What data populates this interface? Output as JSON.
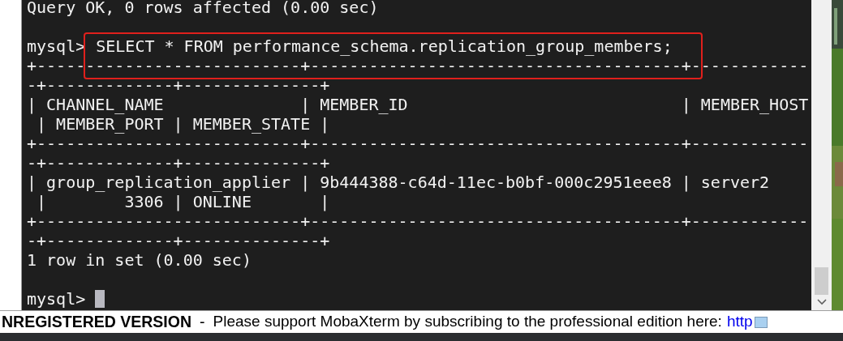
{
  "terminal": {
    "lines": [
      {
        "kind": "output",
        "text": "Query OK, 0 rows affected (0.00 sec)"
      },
      {
        "kind": "blank"
      },
      {
        "kind": "prompt",
        "prompt": "mysql>",
        "command": "SELECT * FROM performance_schema.replication_group_members;",
        "highlighted": true
      },
      {
        "kind": "output",
        "text": "+---------------------------+--------------------------------------+------------"
      },
      {
        "kind": "output",
        "text": "-+-------------+--------------+"
      },
      {
        "kind": "output",
        "text": "| CHANNEL_NAME              | MEMBER_ID                            | MEMBER_HOST"
      },
      {
        "kind": "output",
        "text": " | MEMBER_PORT | MEMBER_STATE |"
      },
      {
        "kind": "output",
        "text": "+---------------------------+--------------------------------------+------------"
      },
      {
        "kind": "output",
        "text": "-+-------------+--------------+"
      },
      {
        "kind": "output",
        "text": "| group_replication_applier | 9b444388-c64d-11ec-b0bf-000c2951eee8 | server2"
      },
      {
        "kind": "output",
        "text": " |        3306 | ONLINE       |"
      },
      {
        "kind": "output",
        "text": "+---------------------------+--------------------------------------+------------"
      },
      {
        "kind": "output",
        "text": "-+-------------+--------------+"
      },
      {
        "kind": "output",
        "text": "1 row in set (0.00 sec)"
      },
      {
        "kind": "blank"
      },
      {
        "kind": "prompt",
        "prompt": "mysql>",
        "cursor": true
      }
    ]
  },
  "banner": {
    "title": "NREGISTERED VERSION",
    "separator": "-",
    "message": "Please support MobaXterm by subscribing to the professional edition here:",
    "link": "http"
  }
}
